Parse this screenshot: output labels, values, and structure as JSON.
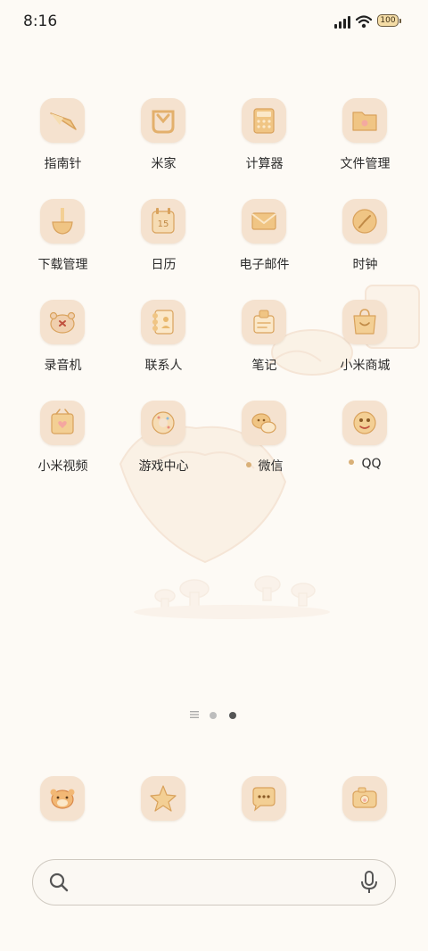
{
  "status_bar": {
    "time": "8:16",
    "battery": "100"
  },
  "apps": [
    {
      "label": "指南针",
      "icon": "compass-icon"
    },
    {
      "label": "米家",
      "icon": "mijia-icon"
    },
    {
      "label": "计算器",
      "icon": "calculator-icon"
    },
    {
      "label": "文件管理",
      "icon": "folder-icon"
    },
    {
      "label": "下载管理",
      "icon": "download-icon"
    },
    {
      "label": "日历",
      "icon": "calendar-icon",
      "date": "15"
    },
    {
      "label": "电子邮件",
      "icon": "mail-icon"
    },
    {
      "label": "时钟",
      "icon": "clock-icon"
    },
    {
      "label": "录音机",
      "icon": "recorder-icon"
    },
    {
      "label": "联系人",
      "icon": "contacts-icon"
    },
    {
      "label": "笔记",
      "icon": "notes-icon"
    },
    {
      "label": "小米商城",
      "icon": "shopping-bag-icon"
    },
    {
      "label": "小米视频",
      "icon": "video-icon"
    },
    {
      "label": "游戏中心",
      "icon": "game-icon"
    },
    {
      "label": "微信",
      "icon": "wechat-icon",
      "new_install_dot": true
    },
    {
      "label": "QQ",
      "icon": "qq-icon",
      "new_install_dot": true
    }
  ],
  "pager": {
    "pages": 2,
    "current_page": 2
  },
  "dock": [
    {
      "icon": "phone-tiger-icon"
    },
    {
      "icon": "star-icon"
    },
    {
      "icon": "messages-icon"
    },
    {
      "icon": "camera-icon"
    }
  ],
  "colors": {
    "background": "#fdfaf5",
    "tile": "#f5e2cf",
    "accent": "#e9b96e",
    "dot": "#d9b078"
  }
}
